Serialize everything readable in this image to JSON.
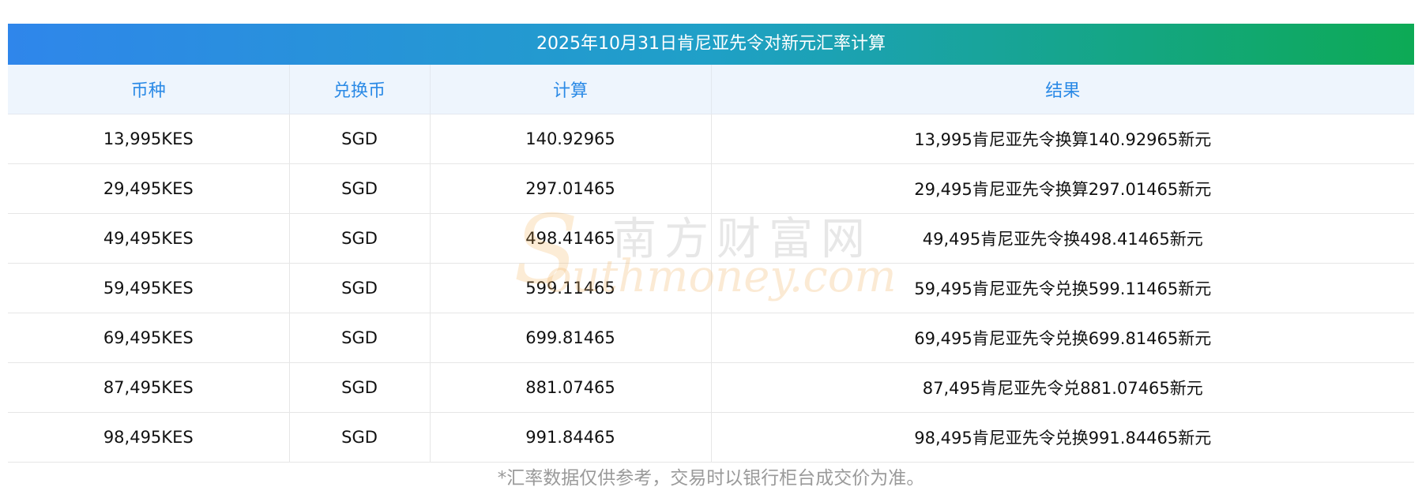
{
  "title": "2025年10月31日肯尼亚先令对新元汇率计算",
  "headers": [
    "币种",
    "兑换币",
    "计算",
    "结果"
  ],
  "rows": [
    [
      "13,995KES",
      "SGD",
      "140.92965",
      "13,995肯尼亚先令换算140.92965新元"
    ],
    [
      "29,495KES",
      "SGD",
      "297.01465",
      "29,495肯尼亚先令换算297.01465新元"
    ],
    [
      "49,495KES",
      "SGD",
      "498.41465",
      "49,495肯尼亚先令换498.41465新元"
    ],
    [
      "59,495KES",
      "SGD",
      "599.11465",
      "59,495肯尼亚先令兑换599.11465新元"
    ],
    [
      "69,495KES",
      "SGD",
      "699.81465",
      "69,495肯尼亚先令兑换699.81465新元"
    ],
    [
      "87,495KES",
      "SGD",
      "881.07465",
      "87,495肯尼亚先令兑881.07465新元"
    ],
    [
      "98,495KES",
      "SGD",
      "991.84465",
      "98,495肯尼亚先令兑换991.84465新元"
    ]
  ],
  "watermark": {
    "cn": "南方财富网",
    "en": "outhmoney.com",
    "logo": "S"
  },
  "footnote": "*汇率数据仅供参考，交易时以银行柜台成交价为准。"
}
